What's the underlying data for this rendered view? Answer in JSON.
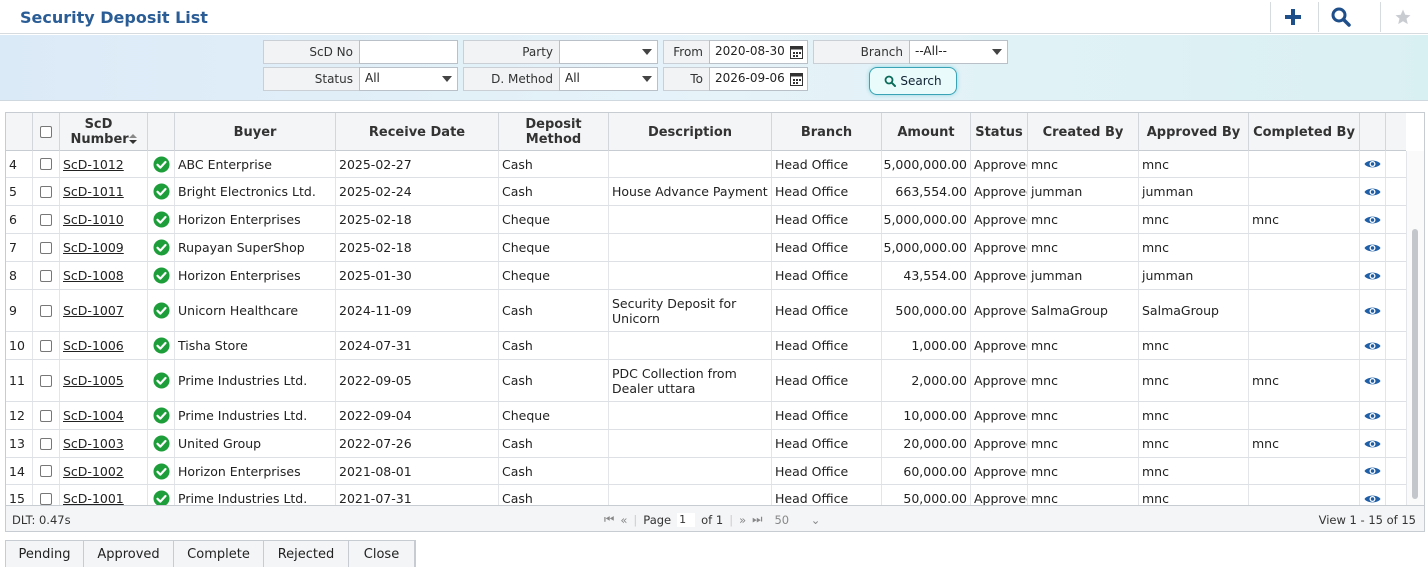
{
  "header": {
    "title": "Security Deposit List"
  },
  "filters": {
    "scd_no_label": "ScD No",
    "scd_no_value": "",
    "party_label": "Party",
    "party_value": "",
    "from_label": "From",
    "from_value": "2020-08-30",
    "branch_label": "Branch",
    "branch_value": "--All--",
    "status_label": "Status",
    "status_value": "All",
    "dmethod_label": "D. Method",
    "dmethod_value": "All",
    "to_label": "To",
    "to_value": "2026-09-06",
    "search_label": "Search"
  },
  "grid": {
    "columns": {
      "scd_number": "ScD Number",
      "buyer": "Buyer",
      "receive_date": "Receive Date",
      "deposit_method": "Deposit Method",
      "description": "Description",
      "branch": "Branch",
      "amount": "Amount",
      "status": "Status",
      "created_by": "Created By",
      "approved_by": "Approved By",
      "completed_by": "Completed By"
    },
    "rows": [
      {
        "n": "4",
        "scd": "ScD-1012",
        "buyer": "ABC Enterprise",
        "date": "2025-02-27",
        "method": "Cash",
        "desc": "",
        "branch": "Head Office",
        "amount": "5,000,000.00",
        "status": "Approved",
        "created": "mnc",
        "approved": "mnc",
        "completed": ""
      },
      {
        "n": "5",
        "scd": "ScD-1011",
        "buyer": "Bright Electronics Ltd.",
        "date": "2025-02-24",
        "method": "Cash",
        "desc": "House Advance Payment",
        "branch": "Head Office",
        "amount": "663,554.00",
        "status": "Approved",
        "created": "jumman",
        "approved": "jumman",
        "completed": ""
      },
      {
        "n": "6",
        "scd": "ScD-1010",
        "buyer": "Horizon Enterprises",
        "date": "2025-02-18",
        "method": "Cheque",
        "desc": "",
        "branch": "Head Office",
        "amount": "5,000,000.00",
        "status": "Approved",
        "created": "mnc",
        "approved": "mnc",
        "completed": "mnc"
      },
      {
        "n": "7",
        "scd": "ScD-1009",
        "buyer": "Rupayan SuperShop",
        "date": "2025-02-18",
        "method": "Cheque",
        "desc": "",
        "branch": "Head Office",
        "amount": "5,000,000.00",
        "status": "Approved",
        "created": "mnc",
        "approved": "mnc",
        "completed": ""
      },
      {
        "n": "8",
        "scd": "ScD-1008",
        "buyer": "Horizon Enterprises",
        "date": "2025-01-30",
        "method": "Cheque",
        "desc": "",
        "branch": "Head Office",
        "amount": "43,554.00",
        "status": "Approved",
        "created": "jumman",
        "approved": "jumman",
        "completed": ""
      },
      {
        "n": "9",
        "scd": "ScD-1007",
        "buyer": "Unicorn Healthcare",
        "date": "2024-11-09",
        "method": "Cash",
        "desc": "Security Deposit for Unicorn",
        "branch": "Head Office",
        "amount": "500,000.00",
        "status": "Approved",
        "created": "SalmaGroup",
        "approved": "SalmaGroup",
        "completed": ""
      },
      {
        "n": "10",
        "scd": "ScD-1006",
        "buyer": "Tisha Store",
        "date": "2024-07-31",
        "method": "Cash",
        "desc": "",
        "branch": "Head Office",
        "amount": "1,000.00",
        "status": "Approved",
        "created": "mnc",
        "approved": "mnc",
        "completed": ""
      },
      {
        "n": "11",
        "scd": "ScD-1005",
        "buyer": "Prime Industries Ltd.",
        "date": "2022-09-05",
        "method": "Cash",
        "desc": "PDC Collection from Dealer uttara",
        "branch": "Head Office",
        "amount": "2,000.00",
        "status": "Approved",
        "created": "mnc",
        "approved": "mnc",
        "completed": "mnc"
      },
      {
        "n": "12",
        "scd": "ScD-1004",
        "buyer": "Prime Industries Ltd.",
        "date": "2022-09-04",
        "method": "Cheque",
        "desc": "",
        "branch": "Head Office",
        "amount": "10,000.00",
        "status": "Approved",
        "created": "mnc",
        "approved": "mnc",
        "completed": ""
      },
      {
        "n": "13",
        "scd": "ScD-1003",
        "buyer": "United Group",
        "date": "2022-07-26",
        "method": "Cash",
        "desc": "",
        "branch": "Head Office",
        "amount": "20,000.00",
        "status": "Approved",
        "created": "mnc",
        "approved": "mnc",
        "completed": "mnc"
      },
      {
        "n": "14",
        "scd": "ScD-1002",
        "buyer": "Horizon Enterprises",
        "date": "2021-08-01",
        "method": "Cash",
        "desc": "",
        "branch": "Head Office",
        "amount": "60,000.00",
        "status": "Approved",
        "created": "mnc",
        "approved": "mnc",
        "completed": ""
      },
      {
        "n": "15",
        "scd": "ScD-1001",
        "buyer": "Prime Industries Ltd.",
        "date": "2021-07-31",
        "method": "Cash",
        "desc": "",
        "branch": "Head Office",
        "amount": "50,000.00",
        "status": "Approved",
        "created": "mnc",
        "approved": "mnc",
        "completed": ""
      }
    ]
  },
  "pager": {
    "dlt": "DLT: 0.47s",
    "page_label": "Page",
    "page_value": "1",
    "of_label": "of 1",
    "page_size": "50",
    "view_info": "View 1 - 15 of 15"
  },
  "tabs": [
    "Pending",
    "Approved",
    "Complete",
    "Rejected",
    "Close"
  ],
  "colors": {
    "title": "#2a5d95",
    "accent": "#1f5fa8",
    "check_green": "#1e9e3a"
  },
  "icons": {
    "add": "plus-icon",
    "search": "magnifier-icon",
    "favorite": "star-icon",
    "view": "eye-icon",
    "approved": "check-circle-icon"
  }
}
